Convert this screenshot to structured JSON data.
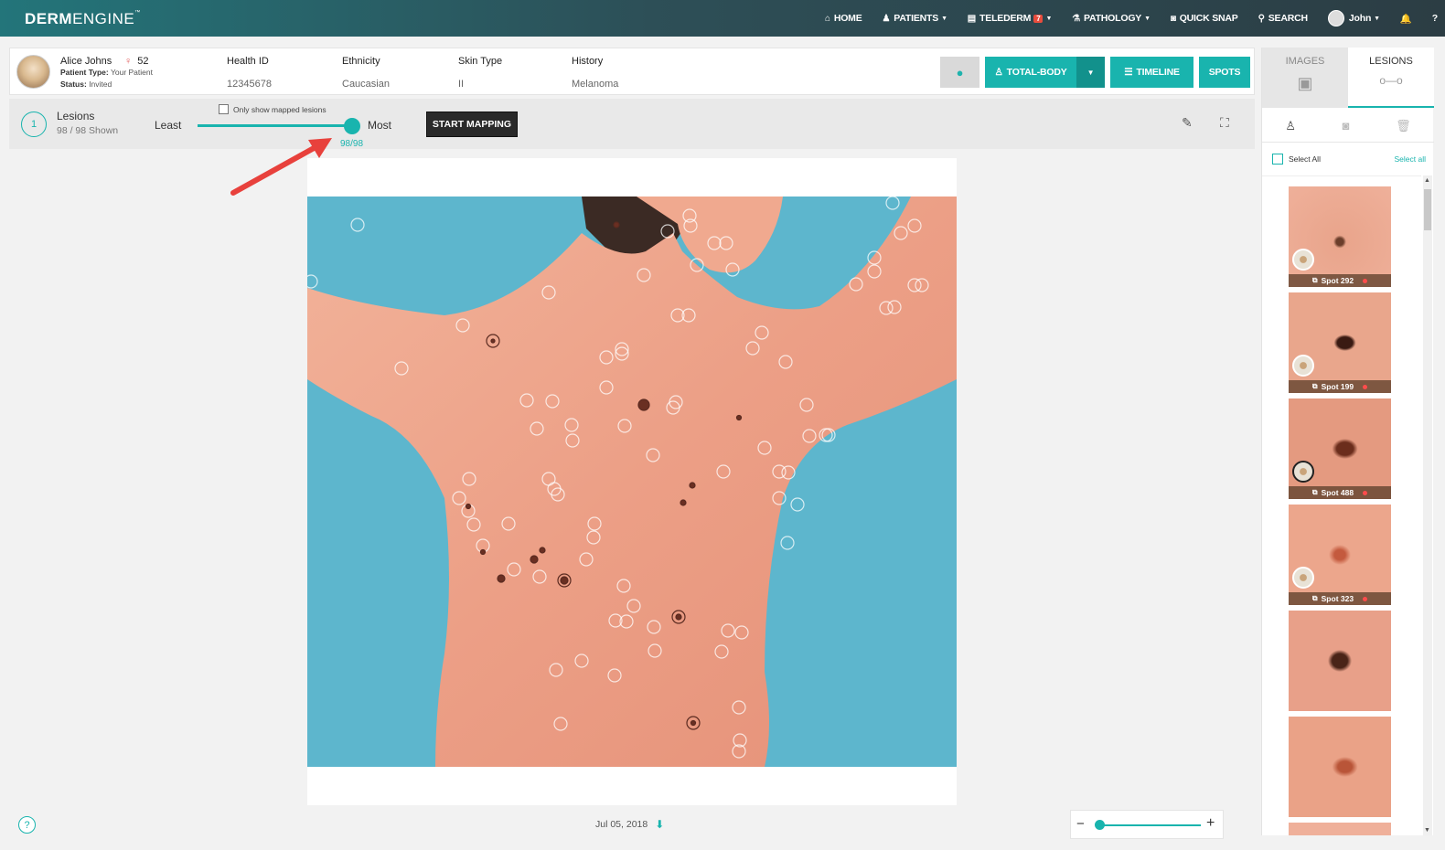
{
  "brand": {
    "bold": "DERM",
    "light": "ENGINE",
    "tm": "™"
  },
  "nav": {
    "home": "HOME",
    "patients": "PATIENTS",
    "telederm": "TELEDERM",
    "telederm_badge": "7",
    "pathology": "PATHOLOGY",
    "quick_snap": "QUICK SNAP",
    "search": "SEARCH",
    "user": "John"
  },
  "patient": {
    "name": "Alice Johns",
    "age": "52",
    "type_label": "Patient Type:",
    "type_value": "Your Patient",
    "status_label": "Status:",
    "status_value": "Invited",
    "health_id_label": "Health ID",
    "health_id": "12345678",
    "ethnicity_label": "Ethnicity",
    "ethnicity": "Caucasian",
    "skin_type_label": "Skin Type",
    "skin_type": "II",
    "history_label": "History",
    "history": "Melanoma"
  },
  "actions": {
    "total_body": "TOTAL-BODY",
    "timeline": "TIMELINE",
    "spots": "SPOTS"
  },
  "lesions_bar": {
    "count_icon": "1",
    "title": "Lesions",
    "shown": "98 / 98 Shown",
    "least": "Least",
    "most": "Most",
    "slider_value": "98/98",
    "only_mapped": "Only show mapped lesions",
    "start_mapping": "START MAPPING"
  },
  "image": {
    "date": "Jul 05, 2018"
  },
  "right_panel": {
    "tab_images": "IMAGES",
    "tab_lesions": "LESIONS",
    "select_all_left": "Select All",
    "select_all_right": "Select all",
    "thumbnails": [
      {
        "label": "Spot 292"
      },
      {
        "label": "Spot 199"
      },
      {
        "label": "Spot 488"
      },
      {
        "label": "Spot 323"
      },
      {
        "label": ""
      },
      {
        "label": ""
      }
    ]
  },
  "colors": {
    "accent": "#19b4ae",
    "nav_start": "#23757a",
    "nav_end": "#2c3d44",
    "arrow": "#e8413c"
  }
}
